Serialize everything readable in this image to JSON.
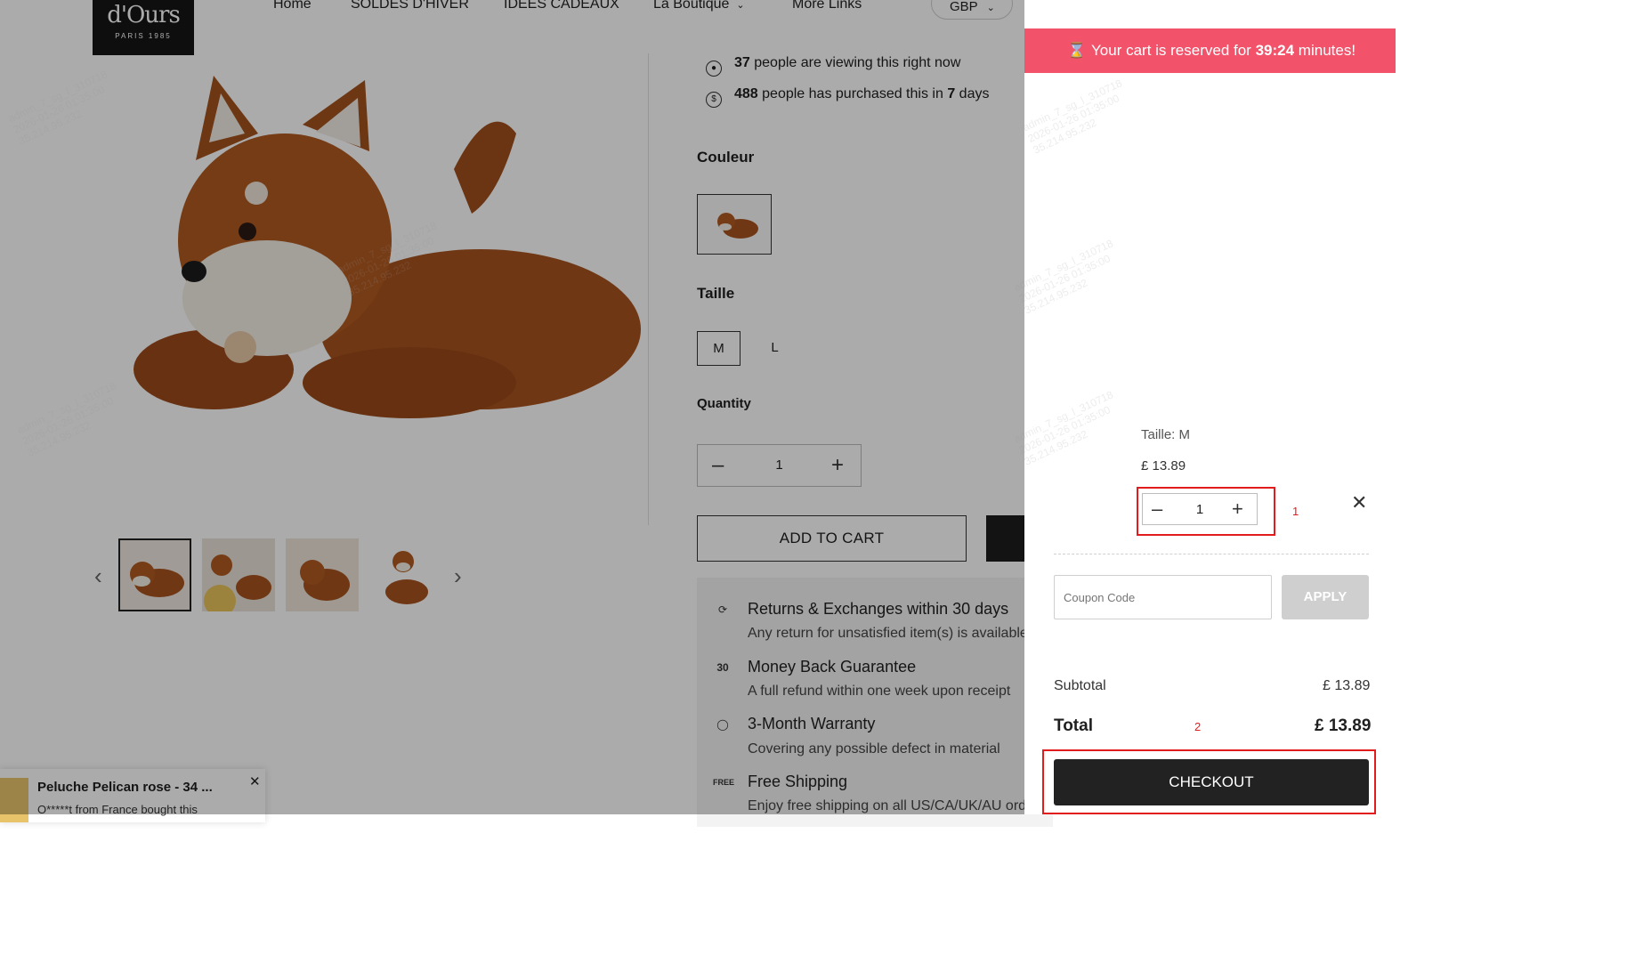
{
  "header": {
    "logo_mark": "d'Ours",
    "logo_sub": "PARIS 1985",
    "nav": [
      "Home",
      "SOLDES D'HIVER",
      "IDEES CADEAUX",
      "La Boutique",
      "More Links"
    ],
    "currency": "GBP"
  },
  "stats": {
    "viewing_count": "37",
    "viewing_text": "people are viewing this right now",
    "purchased_count": "488",
    "purchased_text": "people has purchased this in",
    "purchased_days": "7",
    "purchased_days_unit": "days"
  },
  "options": {
    "color_label": "Couleur",
    "size_label": "Taille",
    "sizes": [
      "M",
      "L"
    ],
    "selected_size": "M",
    "quantity_label": "Quantity",
    "quantity": "1",
    "add_to_cart": "ADD TO CART"
  },
  "features": [
    {
      "icon": "returns-icon",
      "title": "Returns & Exchanges within 30 days",
      "desc": "Any return for unsatisfied item(s) is available"
    },
    {
      "icon": "30-days-icon",
      "title": "Money Back Guarantee",
      "desc": "A full refund within one week upon receipt"
    },
    {
      "icon": "shield-icon",
      "title": "3-Month Warranty",
      "desc": "Covering any possible defect in material"
    },
    {
      "icon": "free-shipping-icon",
      "title": "Free Shipping",
      "desc": "Enjoy free shipping on all US/CA/UK/AU orders"
    }
  ],
  "toast": {
    "title": "Peluche Pelican rose - 34 ...",
    "subtitle": "O*****t from    France bought this"
  },
  "cart": {
    "reserve_prefix": "Your cart is reserved for",
    "reserve_time": "39:24",
    "reserve_suffix": "minutes!",
    "item_variant": "Taille: M",
    "item_price": "£ 13.89",
    "item_qty": "1",
    "coupon_placeholder": "Coupon Code",
    "apply_label": "APPLY",
    "subtotal_label": "Subtotal",
    "subtotal_value": "£ 13.89",
    "total_label": "Total",
    "total_value": "£ 13.89",
    "checkout_label": "CHECKOUT",
    "marker_1": "1",
    "marker_2": "2"
  },
  "colors": {
    "reserve_bar": "#f2526a",
    "checkout_bg": "#222222",
    "annotation": "#e21c1c"
  }
}
